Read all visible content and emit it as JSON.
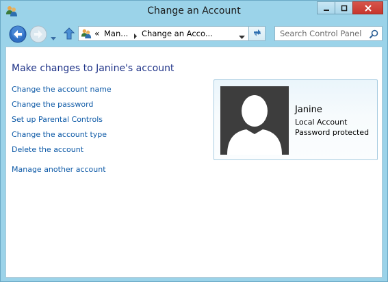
{
  "window": {
    "title": "Change an Account"
  },
  "navigation": {
    "address": {
      "overflow_marker": "«",
      "crumbs": [
        "Man...",
        "Change an Acco..."
      ]
    },
    "search": {
      "placeholder": "Search Control Panel"
    }
  },
  "main": {
    "heading": "Make changes to Janine's account",
    "links": [
      "Change the account name",
      "Change the password",
      "Set up Parental Controls",
      "Change the account type",
      "Delete the account"
    ],
    "manage_link": "Manage another account"
  },
  "account": {
    "name": "Janine",
    "type": "Local Account",
    "status": "Password protected"
  },
  "colors": {
    "frame": "#9bd3e9",
    "heading": "#1e3287",
    "link": "#0b58a6",
    "close_button": "#c7372e",
    "avatar_bg": "#3d3d3d"
  },
  "icons": [
    "users-icon",
    "back-arrow-icon",
    "forward-arrow-icon",
    "up-arrow-icon",
    "refresh-icon",
    "search-icon",
    "user-silhouette-icon"
  ]
}
